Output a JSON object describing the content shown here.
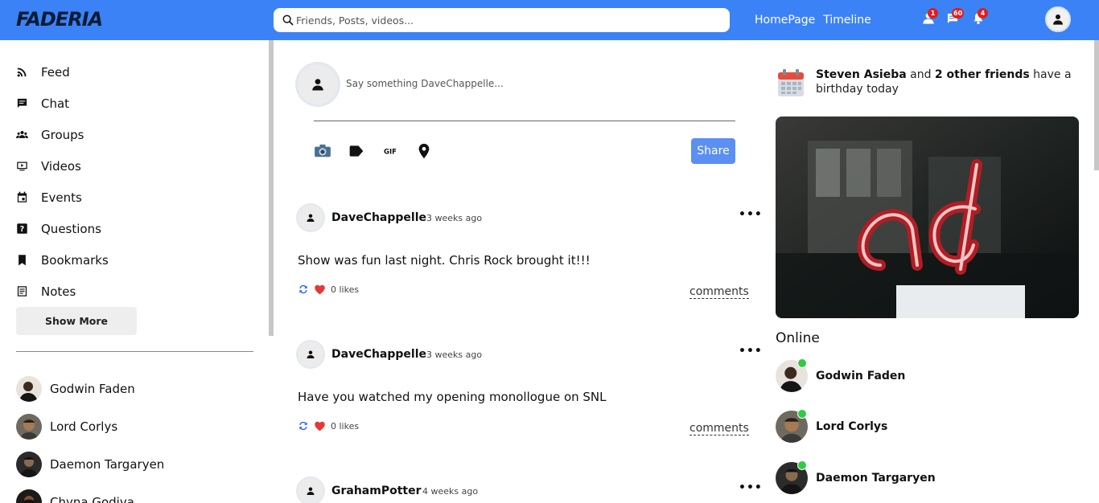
{
  "topbar": {
    "logo": "FADERIA",
    "search_placeholder": "Friends, Posts, videos...",
    "links": [
      "HomePage",
      "Timeline"
    ],
    "notifications": [
      {
        "icon": "person-icon",
        "count": "1"
      },
      {
        "icon": "chat-icon",
        "count": "60"
      },
      {
        "icon": "bell-icon",
        "count": "4"
      }
    ]
  },
  "sidebar": {
    "items": [
      {
        "label": "Feed",
        "icon": "rss-icon"
      },
      {
        "label": "Chat",
        "icon": "chat-icon"
      },
      {
        "label": "Groups",
        "icon": "groups-icon"
      },
      {
        "label": "Videos",
        "icon": "video-icon"
      },
      {
        "label": "Events",
        "icon": "calendar-icon"
      },
      {
        "label": "Questions",
        "icon": "question-icon"
      },
      {
        "label": "Bookmarks",
        "icon": "bookmark-icon"
      },
      {
        "label": "Notes",
        "icon": "notes-icon"
      }
    ],
    "show_more": "Show More",
    "friends": [
      "Godwin Faden",
      "Lord Corlys",
      "Daemon Targaryen",
      "Chyna Godiva"
    ]
  },
  "composer": {
    "placeholder": "Say something DaveChappelle...",
    "share_label": "Share",
    "tools": [
      "camera-icon",
      "tag-icon",
      "gif-icon",
      "location-icon"
    ]
  },
  "posts": [
    {
      "author": "DaveChappelle",
      "time": "3 weeks ago",
      "text": "Show was fun last night. Chris Rock brought it!!!",
      "likes": "0 likes",
      "comments": "comments"
    },
    {
      "author": "DaveChappelle",
      "time": "3 weeks ago",
      "text": "Have you watched my opening monollogue on SNL",
      "likes": "0 likes",
      "comments": "comments"
    },
    {
      "author": "GrahamPotter",
      "time": "4 weeks ago",
      "text": "",
      "likes": "",
      "comments": ""
    }
  ],
  "right": {
    "birthday": {
      "name": "Steven Asieba",
      "connector": " and ",
      "others": "2 other friends",
      "rest": " have a birthday today"
    },
    "online_title": "Online",
    "online": [
      "Godwin Faden",
      "Lord Corlys",
      "Daemon Targaryen"
    ]
  },
  "colors": {
    "topbar": "#3b82f6",
    "share": "#5b8ff2",
    "online_dot": "#2ecc40",
    "badge": "#e11d1d",
    "heart": "#e53935"
  }
}
